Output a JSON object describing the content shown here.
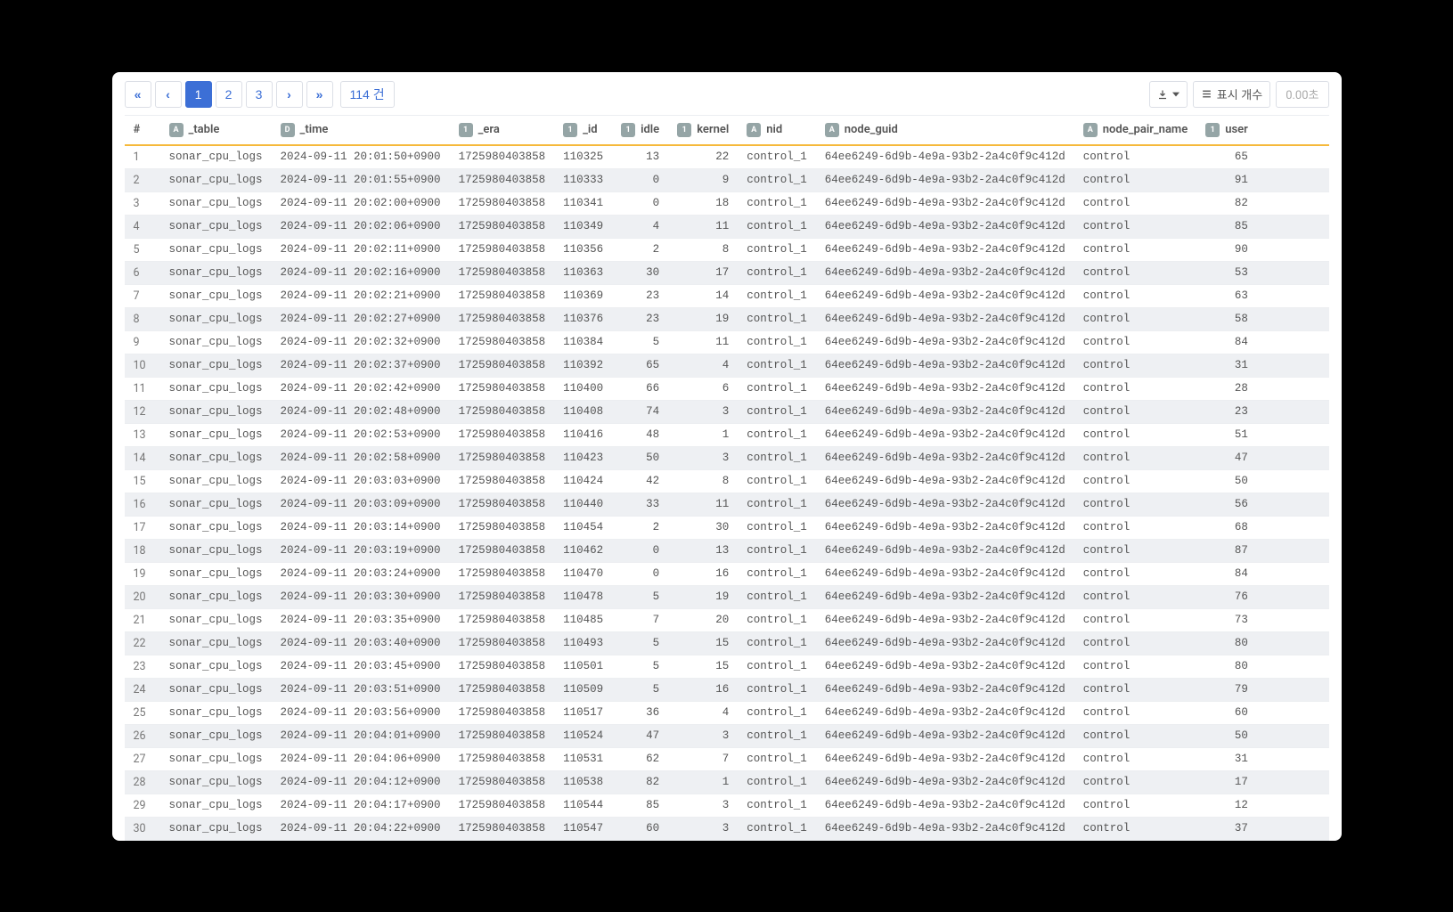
{
  "pager": {
    "first": "«",
    "prev": "‹",
    "next": "›",
    "last": "»",
    "pages": [
      "1",
      "2",
      "3"
    ],
    "active": 0,
    "count_label": "114 건"
  },
  "toolbar": {
    "display_count_label": "표시 개수",
    "elapsed_label": "0.00초"
  },
  "columns": [
    {
      "type": "#",
      "label": "#",
      "badge": ""
    },
    {
      "type": "A",
      "label": "_table",
      "badge": "A"
    },
    {
      "type": "D",
      "label": "_time",
      "badge": "D"
    },
    {
      "type": "1",
      "label": "_era",
      "badge": "1"
    },
    {
      "type": "1",
      "label": "_id",
      "badge": "1"
    },
    {
      "type": "1",
      "label": "idle",
      "badge": "1"
    },
    {
      "type": "1",
      "label": "kernel",
      "badge": "1"
    },
    {
      "type": "A",
      "label": "nid",
      "badge": "A"
    },
    {
      "type": "A",
      "label": "node_guid",
      "badge": "A"
    },
    {
      "type": "A",
      "label": "node_pair_name",
      "badge": "A"
    },
    {
      "type": "1",
      "label": "user",
      "badge": "1"
    }
  ],
  "rows": [
    {
      "n": 1,
      "_table": "sonar_cpu_logs",
      "_time": "2024-09-11 20:01:50+0900",
      "_era": "1725980403858",
      "_id": "110325",
      "idle": 13,
      "kernel": 22,
      "nid": "control_1",
      "node_guid": "64ee6249-6d9b-4e9a-93b2-2a4c0f9c412d",
      "node_pair_name": "control",
      "user": 65
    },
    {
      "n": 2,
      "_table": "sonar_cpu_logs",
      "_time": "2024-09-11 20:01:55+0900",
      "_era": "1725980403858",
      "_id": "110333",
      "idle": 0,
      "kernel": 9,
      "nid": "control_1",
      "node_guid": "64ee6249-6d9b-4e9a-93b2-2a4c0f9c412d",
      "node_pair_name": "control",
      "user": 91
    },
    {
      "n": 3,
      "_table": "sonar_cpu_logs",
      "_time": "2024-09-11 20:02:00+0900",
      "_era": "1725980403858",
      "_id": "110341",
      "idle": 0,
      "kernel": 18,
      "nid": "control_1",
      "node_guid": "64ee6249-6d9b-4e9a-93b2-2a4c0f9c412d",
      "node_pair_name": "control",
      "user": 82
    },
    {
      "n": 4,
      "_table": "sonar_cpu_logs",
      "_time": "2024-09-11 20:02:06+0900",
      "_era": "1725980403858",
      "_id": "110349",
      "idle": 4,
      "kernel": 11,
      "nid": "control_1",
      "node_guid": "64ee6249-6d9b-4e9a-93b2-2a4c0f9c412d",
      "node_pair_name": "control",
      "user": 85
    },
    {
      "n": 5,
      "_table": "sonar_cpu_logs",
      "_time": "2024-09-11 20:02:11+0900",
      "_era": "1725980403858",
      "_id": "110356",
      "idle": 2,
      "kernel": 8,
      "nid": "control_1",
      "node_guid": "64ee6249-6d9b-4e9a-93b2-2a4c0f9c412d",
      "node_pair_name": "control",
      "user": 90
    },
    {
      "n": 6,
      "_table": "sonar_cpu_logs",
      "_time": "2024-09-11 20:02:16+0900",
      "_era": "1725980403858",
      "_id": "110363",
      "idle": 30,
      "kernel": 17,
      "nid": "control_1",
      "node_guid": "64ee6249-6d9b-4e9a-93b2-2a4c0f9c412d",
      "node_pair_name": "control",
      "user": 53
    },
    {
      "n": 7,
      "_table": "sonar_cpu_logs",
      "_time": "2024-09-11 20:02:21+0900",
      "_era": "1725980403858",
      "_id": "110369",
      "idle": 23,
      "kernel": 14,
      "nid": "control_1",
      "node_guid": "64ee6249-6d9b-4e9a-93b2-2a4c0f9c412d",
      "node_pair_name": "control",
      "user": 63
    },
    {
      "n": 8,
      "_table": "sonar_cpu_logs",
      "_time": "2024-09-11 20:02:27+0900",
      "_era": "1725980403858",
      "_id": "110376",
      "idle": 23,
      "kernel": 19,
      "nid": "control_1",
      "node_guid": "64ee6249-6d9b-4e9a-93b2-2a4c0f9c412d",
      "node_pair_name": "control",
      "user": 58
    },
    {
      "n": 9,
      "_table": "sonar_cpu_logs",
      "_time": "2024-09-11 20:02:32+0900",
      "_era": "1725980403858",
      "_id": "110384",
      "idle": 5,
      "kernel": 11,
      "nid": "control_1",
      "node_guid": "64ee6249-6d9b-4e9a-93b2-2a4c0f9c412d",
      "node_pair_name": "control",
      "user": 84
    },
    {
      "n": 10,
      "_table": "sonar_cpu_logs",
      "_time": "2024-09-11 20:02:37+0900",
      "_era": "1725980403858",
      "_id": "110392",
      "idle": 65,
      "kernel": 4,
      "nid": "control_1",
      "node_guid": "64ee6249-6d9b-4e9a-93b2-2a4c0f9c412d",
      "node_pair_name": "control",
      "user": 31
    },
    {
      "n": 11,
      "_table": "sonar_cpu_logs",
      "_time": "2024-09-11 20:02:42+0900",
      "_era": "1725980403858",
      "_id": "110400",
      "idle": 66,
      "kernel": 6,
      "nid": "control_1",
      "node_guid": "64ee6249-6d9b-4e9a-93b2-2a4c0f9c412d",
      "node_pair_name": "control",
      "user": 28
    },
    {
      "n": 12,
      "_table": "sonar_cpu_logs",
      "_time": "2024-09-11 20:02:48+0900",
      "_era": "1725980403858",
      "_id": "110408",
      "idle": 74,
      "kernel": 3,
      "nid": "control_1",
      "node_guid": "64ee6249-6d9b-4e9a-93b2-2a4c0f9c412d",
      "node_pair_name": "control",
      "user": 23
    },
    {
      "n": 13,
      "_table": "sonar_cpu_logs",
      "_time": "2024-09-11 20:02:53+0900",
      "_era": "1725980403858",
      "_id": "110416",
      "idle": 48,
      "kernel": 1,
      "nid": "control_1",
      "node_guid": "64ee6249-6d9b-4e9a-93b2-2a4c0f9c412d",
      "node_pair_name": "control",
      "user": 51
    },
    {
      "n": 14,
      "_table": "sonar_cpu_logs",
      "_time": "2024-09-11 20:02:58+0900",
      "_era": "1725980403858",
      "_id": "110423",
      "idle": 50,
      "kernel": 3,
      "nid": "control_1",
      "node_guid": "64ee6249-6d9b-4e9a-93b2-2a4c0f9c412d",
      "node_pair_name": "control",
      "user": 47
    },
    {
      "n": 15,
      "_table": "sonar_cpu_logs",
      "_time": "2024-09-11 20:03:03+0900",
      "_era": "1725980403858",
      "_id": "110424",
      "idle": 42,
      "kernel": 8,
      "nid": "control_1",
      "node_guid": "64ee6249-6d9b-4e9a-93b2-2a4c0f9c412d",
      "node_pair_name": "control",
      "user": 50
    },
    {
      "n": 16,
      "_table": "sonar_cpu_logs",
      "_time": "2024-09-11 20:03:09+0900",
      "_era": "1725980403858",
      "_id": "110440",
      "idle": 33,
      "kernel": 11,
      "nid": "control_1",
      "node_guid": "64ee6249-6d9b-4e9a-93b2-2a4c0f9c412d",
      "node_pair_name": "control",
      "user": 56
    },
    {
      "n": 17,
      "_table": "sonar_cpu_logs",
      "_time": "2024-09-11 20:03:14+0900",
      "_era": "1725980403858",
      "_id": "110454",
      "idle": 2,
      "kernel": 30,
      "nid": "control_1",
      "node_guid": "64ee6249-6d9b-4e9a-93b2-2a4c0f9c412d",
      "node_pair_name": "control",
      "user": 68
    },
    {
      "n": 18,
      "_table": "sonar_cpu_logs",
      "_time": "2024-09-11 20:03:19+0900",
      "_era": "1725980403858",
      "_id": "110462",
      "idle": 0,
      "kernel": 13,
      "nid": "control_1",
      "node_guid": "64ee6249-6d9b-4e9a-93b2-2a4c0f9c412d",
      "node_pair_name": "control",
      "user": 87
    },
    {
      "n": 19,
      "_table": "sonar_cpu_logs",
      "_time": "2024-09-11 20:03:24+0900",
      "_era": "1725980403858",
      "_id": "110470",
      "idle": 0,
      "kernel": 16,
      "nid": "control_1",
      "node_guid": "64ee6249-6d9b-4e9a-93b2-2a4c0f9c412d",
      "node_pair_name": "control",
      "user": 84
    },
    {
      "n": 20,
      "_table": "sonar_cpu_logs",
      "_time": "2024-09-11 20:03:30+0900",
      "_era": "1725980403858",
      "_id": "110478",
      "idle": 5,
      "kernel": 19,
      "nid": "control_1",
      "node_guid": "64ee6249-6d9b-4e9a-93b2-2a4c0f9c412d",
      "node_pair_name": "control",
      "user": 76
    },
    {
      "n": 21,
      "_table": "sonar_cpu_logs",
      "_time": "2024-09-11 20:03:35+0900",
      "_era": "1725980403858",
      "_id": "110485",
      "idle": 7,
      "kernel": 20,
      "nid": "control_1",
      "node_guid": "64ee6249-6d9b-4e9a-93b2-2a4c0f9c412d",
      "node_pair_name": "control",
      "user": 73
    },
    {
      "n": 22,
      "_table": "sonar_cpu_logs",
      "_time": "2024-09-11 20:03:40+0900",
      "_era": "1725980403858",
      "_id": "110493",
      "idle": 5,
      "kernel": 15,
      "nid": "control_1",
      "node_guid": "64ee6249-6d9b-4e9a-93b2-2a4c0f9c412d",
      "node_pair_name": "control",
      "user": 80
    },
    {
      "n": 23,
      "_table": "sonar_cpu_logs",
      "_time": "2024-09-11 20:03:45+0900",
      "_era": "1725980403858",
      "_id": "110501",
      "idle": 5,
      "kernel": 15,
      "nid": "control_1",
      "node_guid": "64ee6249-6d9b-4e9a-93b2-2a4c0f9c412d",
      "node_pair_name": "control",
      "user": 80
    },
    {
      "n": 24,
      "_table": "sonar_cpu_logs",
      "_time": "2024-09-11 20:03:51+0900",
      "_era": "1725980403858",
      "_id": "110509",
      "idle": 5,
      "kernel": 16,
      "nid": "control_1",
      "node_guid": "64ee6249-6d9b-4e9a-93b2-2a4c0f9c412d",
      "node_pair_name": "control",
      "user": 79
    },
    {
      "n": 25,
      "_table": "sonar_cpu_logs",
      "_time": "2024-09-11 20:03:56+0900",
      "_era": "1725980403858",
      "_id": "110517",
      "idle": 36,
      "kernel": 4,
      "nid": "control_1",
      "node_guid": "64ee6249-6d9b-4e9a-93b2-2a4c0f9c412d",
      "node_pair_name": "control",
      "user": 60
    },
    {
      "n": 26,
      "_table": "sonar_cpu_logs",
      "_time": "2024-09-11 20:04:01+0900",
      "_era": "1725980403858",
      "_id": "110524",
      "idle": 47,
      "kernel": 3,
      "nid": "control_1",
      "node_guid": "64ee6249-6d9b-4e9a-93b2-2a4c0f9c412d",
      "node_pair_name": "control",
      "user": 50
    },
    {
      "n": 27,
      "_table": "sonar_cpu_logs",
      "_time": "2024-09-11 20:04:06+0900",
      "_era": "1725980403858",
      "_id": "110531",
      "idle": 62,
      "kernel": 7,
      "nid": "control_1",
      "node_guid": "64ee6249-6d9b-4e9a-93b2-2a4c0f9c412d",
      "node_pair_name": "control",
      "user": 31
    },
    {
      "n": 28,
      "_table": "sonar_cpu_logs",
      "_time": "2024-09-11 20:04:12+0900",
      "_era": "1725980403858",
      "_id": "110538",
      "idle": 82,
      "kernel": 1,
      "nid": "control_1",
      "node_guid": "64ee6249-6d9b-4e9a-93b2-2a4c0f9c412d",
      "node_pair_name": "control",
      "user": 17
    },
    {
      "n": 29,
      "_table": "sonar_cpu_logs",
      "_time": "2024-09-11 20:04:17+0900",
      "_era": "1725980403858",
      "_id": "110544",
      "idle": 85,
      "kernel": 3,
      "nid": "control_1",
      "node_guid": "64ee6249-6d9b-4e9a-93b2-2a4c0f9c412d",
      "node_pair_name": "control",
      "user": 12
    },
    {
      "n": 30,
      "_table": "sonar_cpu_logs",
      "_time": "2024-09-11 20:04:22+0900",
      "_era": "1725980403858",
      "_id": "110547",
      "idle": 60,
      "kernel": 3,
      "nid": "control_1",
      "node_guid": "64ee6249-6d9b-4e9a-93b2-2a4c0f9c412d",
      "node_pair_name": "control",
      "user": 37
    }
  ]
}
